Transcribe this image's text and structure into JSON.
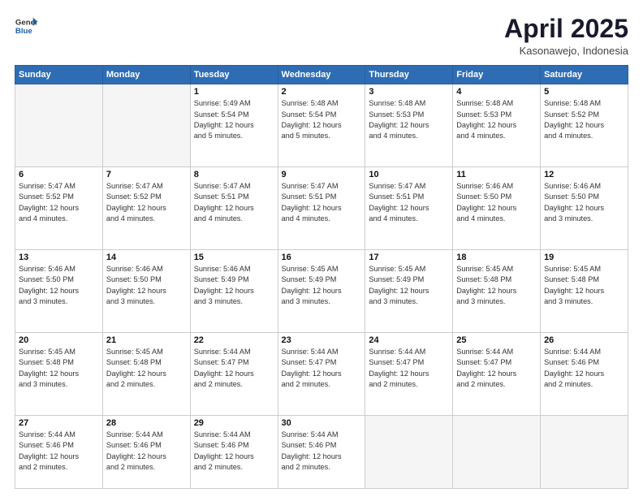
{
  "header": {
    "logo_general": "General",
    "logo_blue": "Blue",
    "title": "April 2025",
    "location": "Kasonawejo, Indonesia"
  },
  "days_of_week": [
    "Sunday",
    "Monday",
    "Tuesday",
    "Wednesday",
    "Thursday",
    "Friday",
    "Saturday"
  ],
  "weeks": [
    [
      {
        "day": "",
        "empty": true
      },
      {
        "day": "",
        "empty": true
      },
      {
        "day": "1",
        "sunrise": "5:49 AM",
        "sunset": "5:54 PM",
        "daylight": "12 hours and 5 minutes."
      },
      {
        "day": "2",
        "sunrise": "5:48 AM",
        "sunset": "5:54 PM",
        "daylight": "12 hours and 5 minutes."
      },
      {
        "day": "3",
        "sunrise": "5:48 AM",
        "sunset": "5:53 PM",
        "daylight": "12 hours and 4 minutes."
      },
      {
        "day": "4",
        "sunrise": "5:48 AM",
        "sunset": "5:53 PM",
        "daylight": "12 hours and 4 minutes."
      },
      {
        "day": "5",
        "sunrise": "5:48 AM",
        "sunset": "5:52 PM",
        "daylight": "12 hours and 4 minutes."
      }
    ],
    [
      {
        "day": "6",
        "sunrise": "5:47 AM",
        "sunset": "5:52 PM",
        "daylight": "12 hours and 4 minutes."
      },
      {
        "day": "7",
        "sunrise": "5:47 AM",
        "sunset": "5:52 PM",
        "daylight": "12 hours and 4 minutes."
      },
      {
        "day": "8",
        "sunrise": "5:47 AM",
        "sunset": "5:51 PM",
        "daylight": "12 hours and 4 minutes."
      },
      {
        "day": "9",
        "sunrise": "5:47 AM",
        "sunset": "5:51 PM",
        "daylight": "12 hours and 4 minutes."
      },
      {
        "day": "10",
        "sunrise": "5:47 AM",
        "sunset": "5:51 PM",
        "daylight": "12 hours and 4 minutes."
      },
      {
        "day": "11",
        "sunrise": "5:46 AM",
        "sunset": "5:50 PM",
        "daylight": "12 hours and 4 minutes."
      },
      {
        "day": "12",
        "sunrise": "5:46 AM",
        "sunset": "5:50 PM",
        "daylight": "12 hours and 3 minutes."
      }
    ],
    [
      {
        "day": "13",
        "sunrise": "5:46 AM",
        "sunset": "5:50 PM",
        "daylight": "12 hours and 3 minutes."
      },
      {
        "day": "14",
        "sunrise": "5:46 AM",
        "sunset": "5:50 PM",
        "daylight": "12 hours and 3 minutes."
      },
      {
        "day": "15",
        "sunrise": "5:46 AM",
        "sunset": "5:49 PM",
        "daylight": "12 hours and 3 minutes."
      },
      {
        "day": "16",
        "sunrise": "5:45 AM",
        "sunset": "5:49 PM",
        "daylight": "12 hours and 3 minutes."
      },
      {
        "day": "17",
        "sunrise": "5:45 AM",
        "sunset": "5:49 PM",
        "daylight": "12 hours and 3 minutes."
      },
      {
        "day": "18",
        "sunrise": "5:45 AM",
        "sunset": "5:48 PM",
        "daylight": "12 hours and 3 minutes."
      },
      {
        "day": "19",
        "sunrise": "5:45 AM",
        "sunset": "5:48 PM",
        "daylight": "12 hours and 3 minutes."
      }
    ],
    [
      {
        "day": "20",
        "sunrise": "5:45 AM",
        "sunset": "5:48 PM",
        "daylight": "12 hours and 3 minutes."
      },
      {
        "day": "21",
        "sunrise": "5:45 AM",
        "sunset": "5:48 PM",
        "daylight": "12 hours and 2 minutes."
      },
      {
        "day": "22",
        "sunrise": "5:44 AM",
        "sunset": "5:47 PM",
        "daylight": "12 hours and 2 minutes."
      },
      {
        "day": "23",
        "sunrise": "5:44 AM",
        "sunset": "5:47 PM",
        "daylight": "12 hours and 2 minutes."
      },
      {
        "day": "24",
        "sunrise": "5:44 AM",
        "sunset": "5:47 PM",
        "daylight": "12 hours and 2 minutes."
      },
      {
        "day": "25",
        "sunrise": "5:44 AM",
        "sunset": "5:47 PM",
        "daylight": "12 hours and 2 minutes."
      },
      {
        "day": "26",
        "sunrise": "5:44 AM",
        "sunset": "5:46 PM",
        "daylight": "12 hours and 2 minutes."
      }
    ],
    [
      {
        "day": "27",
        "sunrise": "5:44 AM",
        "sunset": "5:46 PM",
        "daylight": "12 hours and 2 minutes."
      },
      {
        "day": "28",
        "sunrise": "5:44 AM",
        "sunset": "5:46 PM",
        "daylight": "12 hours and 2 minutes."
      },
      {
        "day": "29",
        "sunrise": "5:44 AM",
        "sunset": "5:46 PM",
        "daylight": "12 hours and 2 minutes."
      },
      {
        "day": "30",
        "sunrise": "5:44 AM",
        "sunset": "5:46 PM",
        "daylight": "12 hours and 2 minutes."
      },
      {
        "day": "",
        "empty": true
      },
      {
        "day": "",
        "empty": true
      },
      {
        "day": "",
        "empty": true
      }
    ]
  ],
  "labels": {
    "sunrise": "Sunrise:",
    "sunset": "Sunset:",
    "daylight": "Daylight:"
  }
}
